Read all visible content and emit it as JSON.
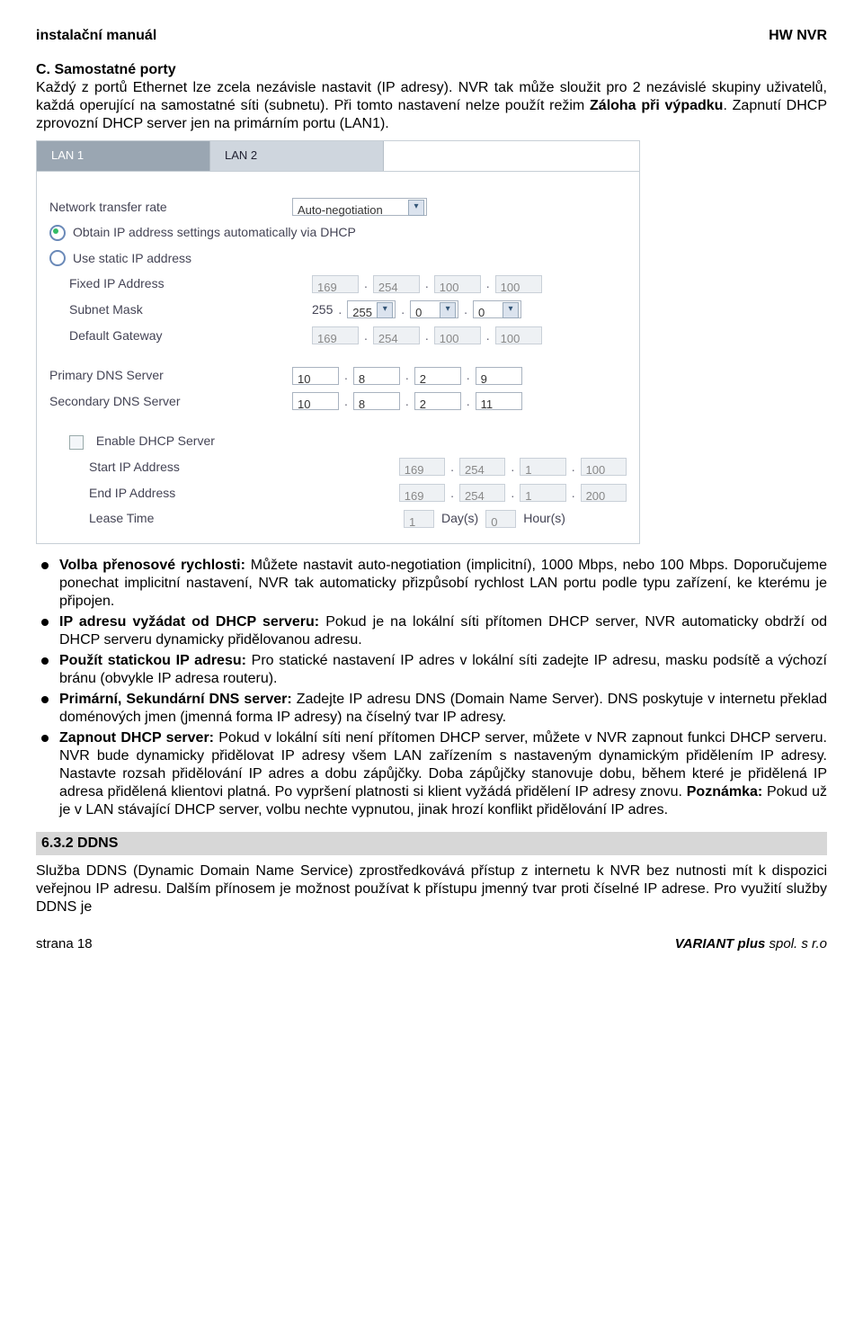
{
  "header": {
    "left": "instalační manuál",
    "right": "HW NVR"
  },
  "section_c": {
    "title": "C. Samostatné porty",
    "p1a": "Každý z portů Ethernet lze zcela nezávisle nastavit (IP adresy). NVR tak může sloužit pro 2 nezávislé skupiny uživatelů, každá operující na samostatné síti (subnetu). Při tomto nastavení nelze použít režim ",
    "p1b": "Záloha při výpadku",
    "p1c": ". Zapnutí DHCP zprovozní DHCP server jen na primárním portu (LAN1)."
  },
  "config": {
    "tab1": "LAN 1",
    "tab2": "LAN 2",
    "transfer_label": "Network transfer rate",
    "transfer_value": "Auto-negotiation",
    "radio_dhcp": "Obtain IP address settings automatically via DHCP",
    "radio_static": "Use static IP address",
    "fixed_ip_label": "Fixed IP Address",
    "fixed_ip": [
      "169",
      "254",
      "100",
      "100"
    ],
    "subnet_label": "Subnet Mask",
    "subnet": [
      "255",
      "255",
      "0",
      "0"
    ],
    "gateway_label": "Default Gateway",
    "gateway": [
      "169",
      "254",
      "100",
      "100"
    ],
    "pdns_label": "Primary DNS Server",
    "pdns": [
      "10",
      "8",
      "2",
      "9"
    ],
    "sdns_label": "Secondary DNS Server",
    "sdns": [
      "10",
      "8",
      "2",
      "11"
    ],
    "enable_dhcp": "Enable DHCP Server",
    "start_label": "Start IP Address",
    "start_ip": [
      "169",
      "254",
      "1",
      "100"
    ],
    "end_label": "End IP Address",
    "end_ip": [
      "169",
      "254",
      "1",
      "200"
    ],
    "lease_label": "Lease Time",
    "lease_days_val": "1",
    "lease_days_unit": "Day(s)",
    "lease_hours_val": "0",
    "lease_hours_unit": "Hour(s)"
  },
  "bullets": {
    "b1_bold": "Volba přenosové rychlosti:",
    "b1_rest": " Můžete nastavit auto-negotiation (implicitní), 1000 Mbps, nebo 100 Mbps. Doporučujeme ponechat implicitní nastavení, NVR tak automaticky přizpůsobí rychlost LAN portu podle typu zařízení, ke kterému je připojen.",
    "b2_bold": "IP adresu vyžádat od DHCP serveru:",
    "b2_rest": " Pokud je na lokální síti přítomen DHCP server, NVR automaticky obdrží od DHCP serveru dynamicky přidělovanou adresu.",
    "b3_bold": "Použít statickou IP adresu:",
    "b3_rest": " Pro statické nastavení IP adres v lokální síti zadejte IP adresu, masku podsítě a výchozí bránu (obvykle IP adresa routeru).",
    "b4_bold": "Primární, Sekundární DNS server:",
    "b4_rest": " Zadejte IP adresu DNS (Domain Name Server). DNS poskytuje v internetu překlad doménových jmen (jmenná forma IP adresy) na číselný tvar IP adresy.",
    "b5_bold": "Zapnout DHCP server:",
    "b5_mid": " Pokud v lokální síti není přítomen DHCP server, můžete v NVR zapnout funkci DHCP serveru. NVR bude dynamicky přidělovat IP adresy všem LAN zařízením s nastaveným dynamickým přidělením IP adresy. Nastavte rozsah přidělování IP adres a dobu zápůjčky. Doba zápůjčky stanovuje dobu, během které je přidělená IP adresa přidělená klientovi platná. Po vypršení platnosti si klient vyžádá přidělení IP adresy znovu. ",
    "b5_note_bold": "Poznámka:",
    "b5_note_rest": " Pokud už je v LAN stávající DHCP server, volbu nechte vypnutou, jinak hrozí konflikt přidělování IP adres."
  },
  "ddns": {
    "heading": "6.3.2 DDNS",
    "text": "Služba DDNS (Dynamic Domain Name Service) zprostředkovává přístup z internetu k NVR bez nutnosti mít k dispozici veřejnou IP adresu. Dalším přínosem je možnost používat k přístupu jmenný tvar proti číselné IP adrese. Pro využití služby DDNS je"
  },
  "footer": {
    "left": "strana 18",
    "right_bold": "VARIANT plus",
    "right_rest": " spol. s r.o"
  }
}
